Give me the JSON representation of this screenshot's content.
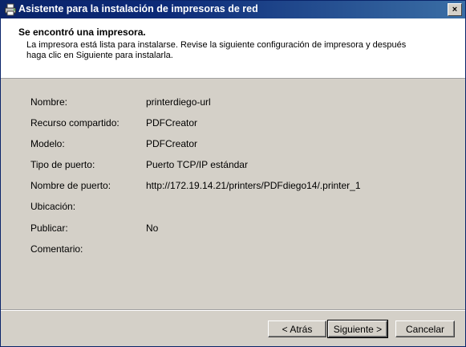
{
  "window": {
    "title": "Asistente para la instalación de impresoras de red",
    "close_label": "×"
  },
  "header": {
    "title": "Se encontró una impresora.",
    "description": "La impresora está lista para instalarse. Revise la siguiente configuración de impresora y después haga clic en Siguiente para instalarla."
  },
  "details": [
    {
      "label": "Nombre:",
      "value": "printerdiego-url"
    },
    {
      "label": "Recurso compartido:",
      "value": "PDFCreator"
    },
    {
      "label": "Modelo:",
      "value": "PDFCreator"
    },
    {
      "label": "Tipo de puerto:",
      "value": "Puerto TCP/IP estándar"
    },
    {
      "label": "Nombre de puerto:",
      "value": "http://172.19.14.21/printers/PDFdiego14/.printer_1"
    },
    {
      "label": "Ubicación:",
      "value": ""
    },
    {
      "label": "Publicar:",
      "value": "No"
    },
    {
      "label": "Comentario:",
      "value": ""
    }
  ],
  "buttons": {
    "back": "< Atrás",
    "next": "Siguiente >",
    "cancel": "Cancelar"
  },
  "icons": {
    "title": "printer-icon"
  }
}
